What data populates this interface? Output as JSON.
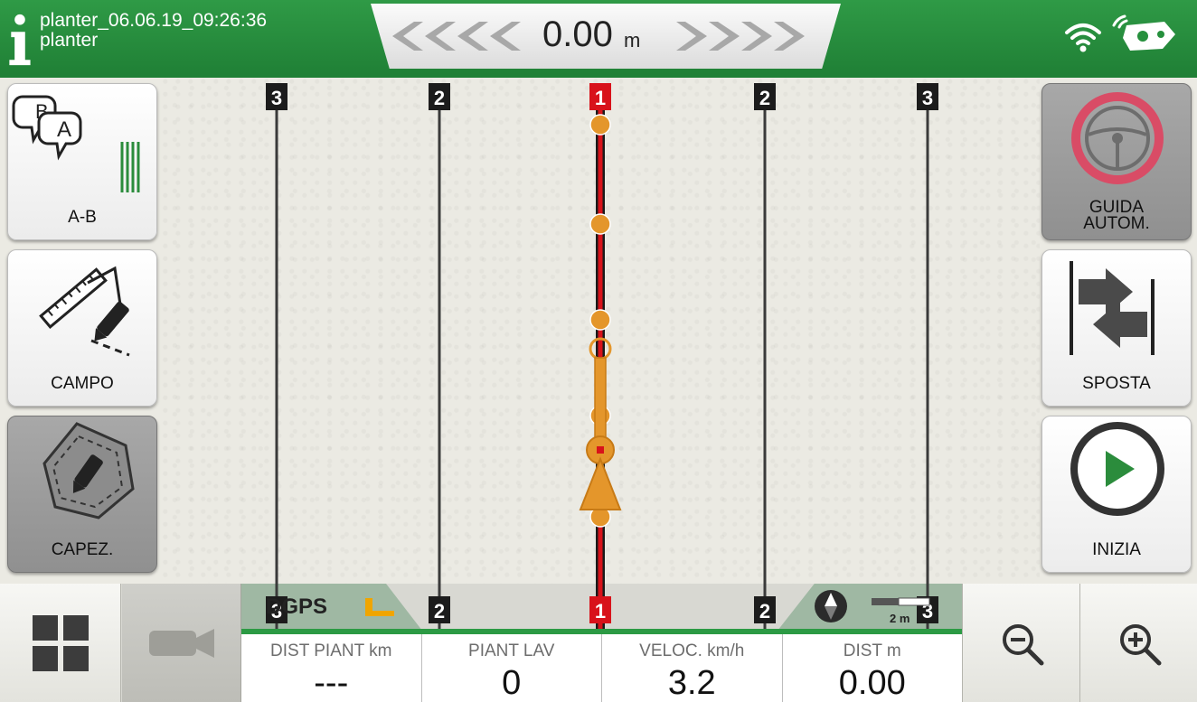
{
  "header": {
    "info_line1": "planter_06.06.19_09:26:36",
    "info_line2": "planter",
    "offset_value": "0.00",
    "offset_unit": "m"
  },
  "left_buttons": [
    {
      "label": "A-B",
      "icon": "ab-line-icon"
    },
    {
      "label": "CAMPO",
      "icon": "field-edit-icon"
    },
    {
      "label": "CAPEZ.",
      "icon": "headland-icon"
    }
  ],
  "right_buttons": [
    {
      "label": "GUIDA\nAUTOM.",
      "icon": "steering-wheel-icon"
    },
    {
      "label": "SPOSTA",
      "icon": "shift-line-icon"
    },
    {
      "label": "INIZIA",
      "icon": "play-icon"
    }
  ],
  "map": {
    "line_labels_top": [
      "3",
      "2",
      "1",
      "2",
      "3"
    ],
    "line_labels_bottom": [
      "3",
      "2",
      "1",
      "2",
      "3"
    ],
    "colors": {
      "active_line": "#d8121a",
      "guide_line": "#3a3a3a",
      "vehicle": "#e4962b",
      "label_bg": "#1c1c1c"
    }
  },
  "status": {
    "gps_mode": "DGPS",
    "scale": "2 m"
  },
  "info_cells": [
    {
      "title": "DIST PIANT km",
      "value": "---"
    },
    {
      "title": "PIANT LAV",
      "value": "0"
    },
    {
      "title": "VELOC. km/h",
      "value": "3.2"
    },
    {
      "title": "DIST m",
      "value": "0.00"
    }
  ],
  "colors": {
    "header_green": "#26903d",
    "panel_gray": "#9a9a9a",
    "steering_ring": "#d94c66",
    "play_green": "#2b8c3c"
  }
}
